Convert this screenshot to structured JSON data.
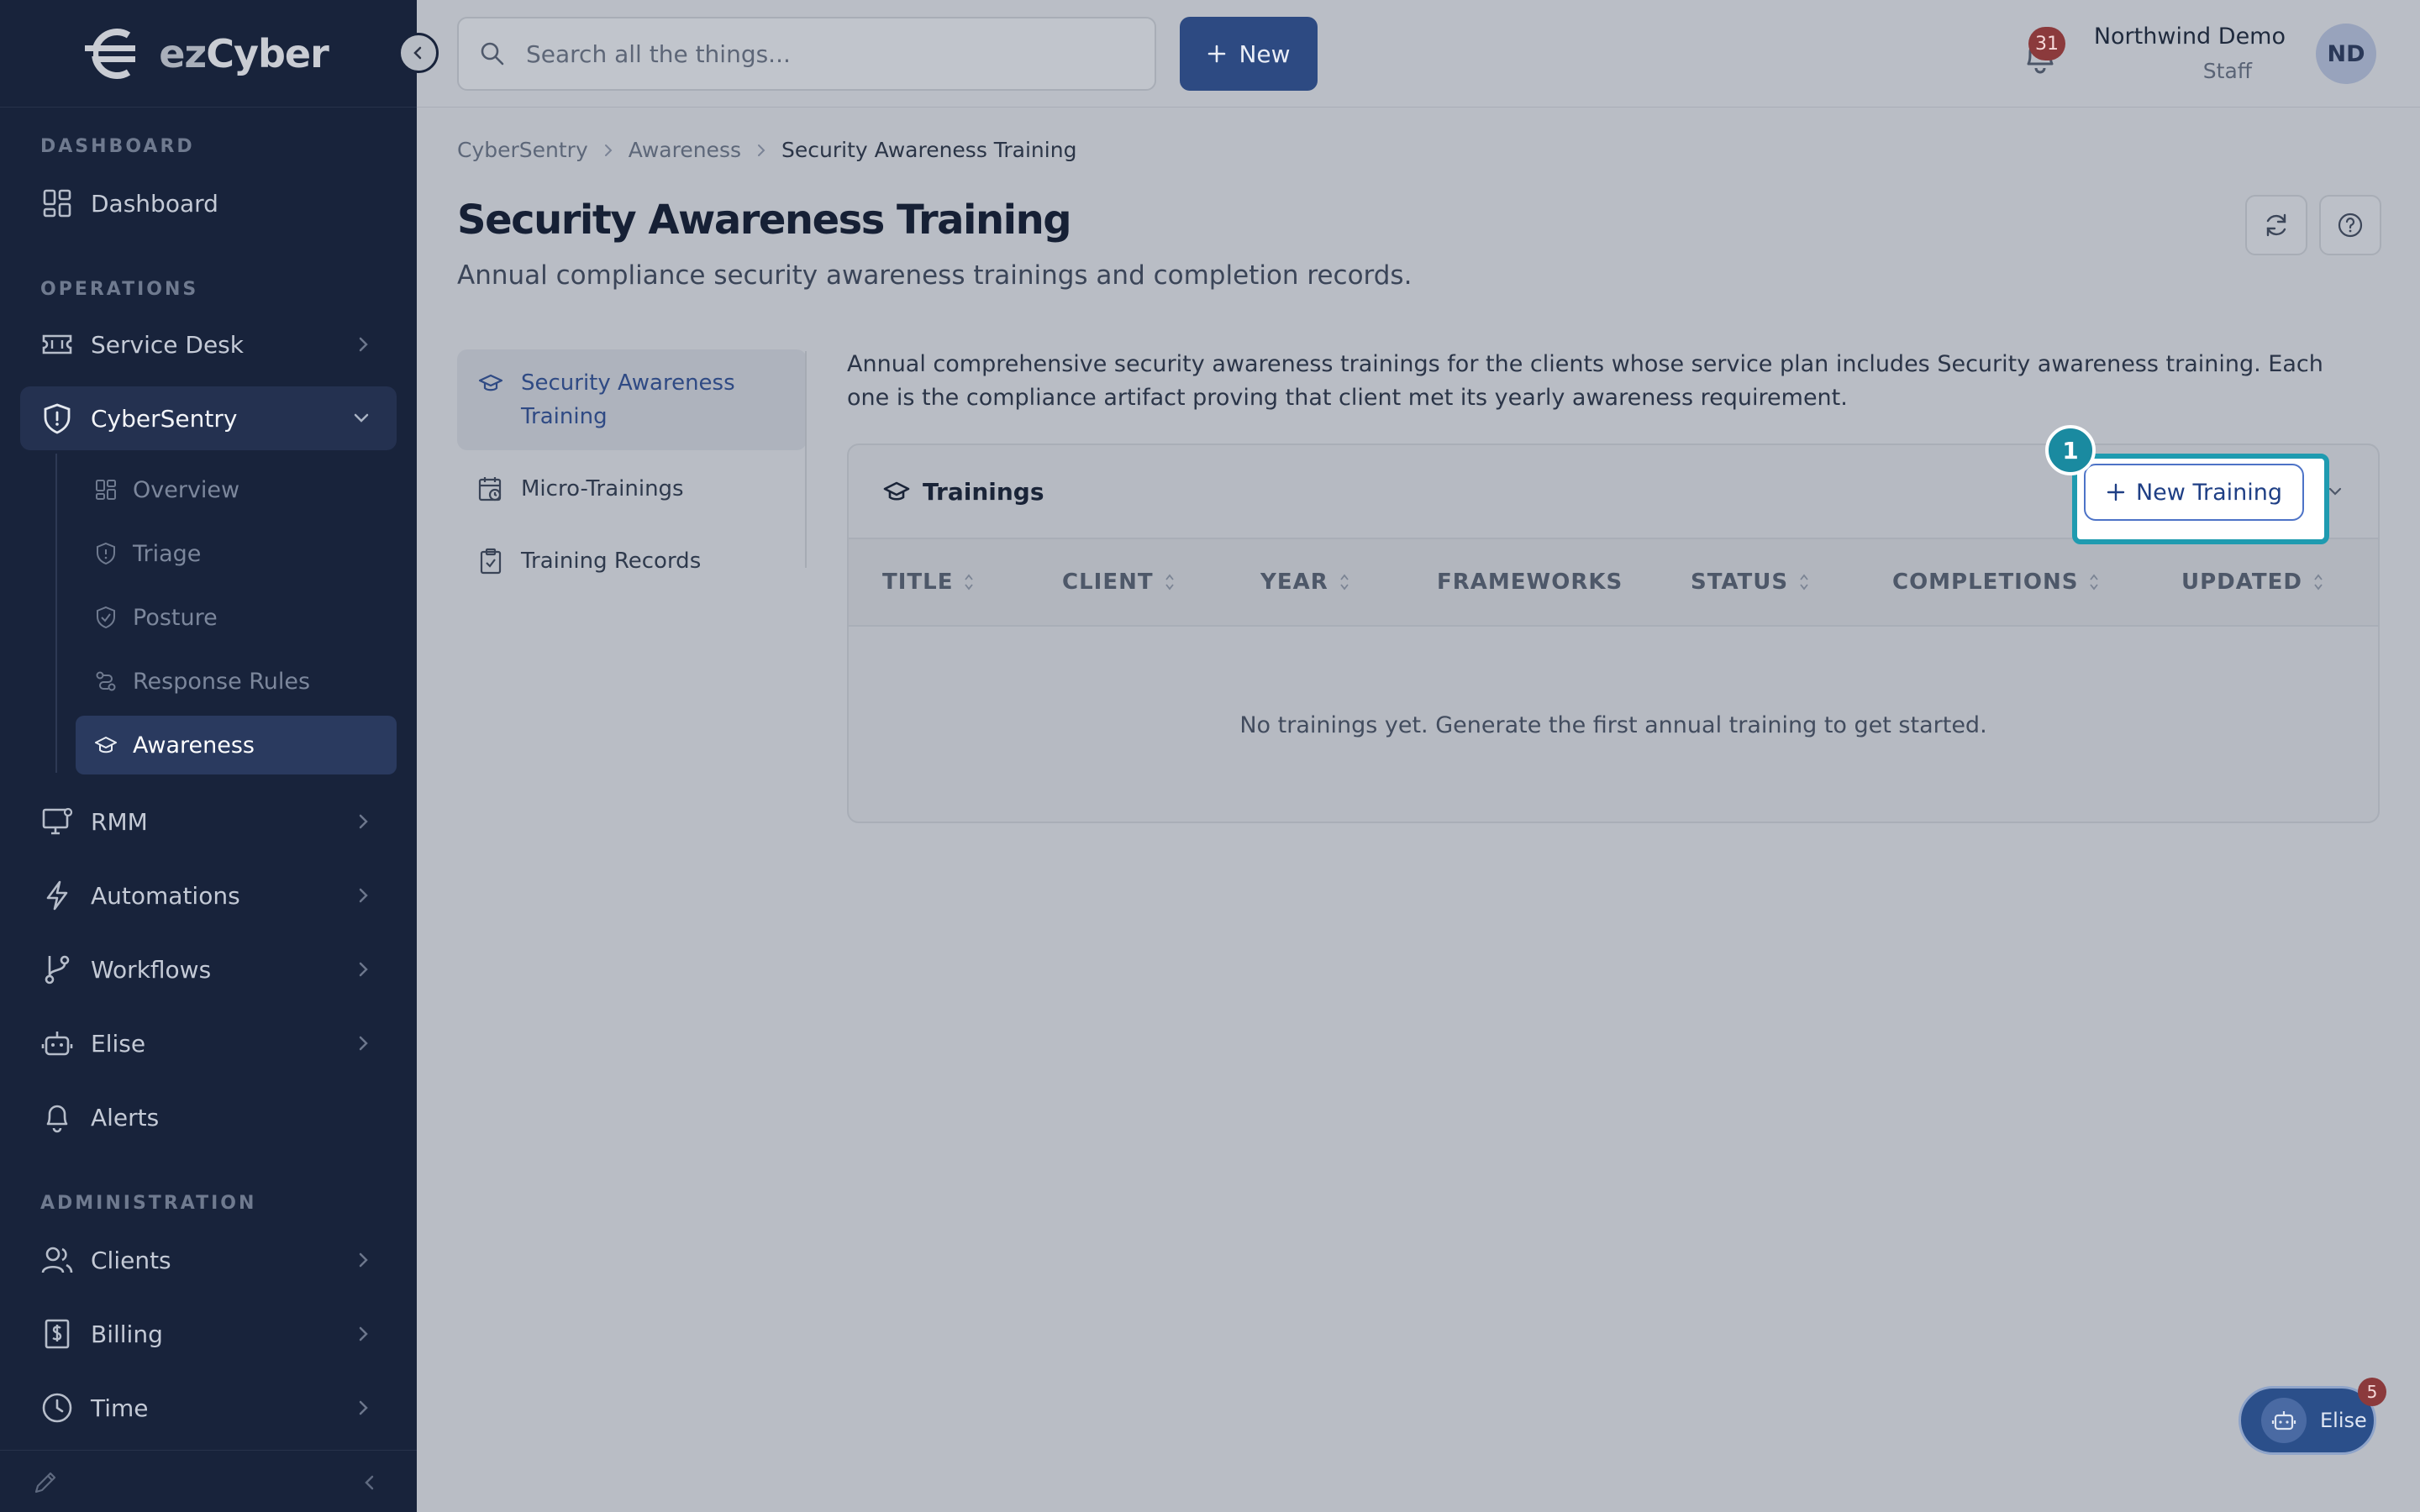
{
  "brand": {
    "name_prefix": "ez",
    "name_suffix": "Cyber"
  },
  "sidebar": {
    "sections": [
      "DASHBOARD",
      "OPERATIONS",
      "ADMINISTRATION"
    ],
    "items": [
      {
        "label": "Dashboard",
        "icon": "grid-icon"
      },
      {
        "label": "Service Desk",
        "icon": "ticket-icon"
      },
      {
        "label": "CyberSentry",
        "icon": "shield-icon",
        "expanded": true
      },
      {
        "label": "RMM",
        "icon": "monitor-icon"
      },
      {
        "label": "Automations",
        "icon": "bolt-icon"
      },
      {
        "label": "Workflows",
        "icon": "branch-icon"
      },
      {
        "label": "Elise",
        "icon": "robot-icon"
      },
      {
        "label": "Alerts",
        "icon": "bell-icon"
      },
      {
        "label": "Clients",
        "icon": "users-icon"
      },
      {
        "label": "Billing",
        "icon": "dollar-icon"
      },
      {
        "label": "Time",
        "icon": "clock-icon"
      }
    ],
    "subitems": [
      {
        "label": "Overview",
        "icon": "grid-icon"
      },
      {
        "label": "Triage",
        "icon": "shield-icon"
      },
      {
        "label": "Posture",
        "icon": "shield-check-icon"
      },
      {
        "label": "Response Rules",
        "icon": "route-icon"
      },
      {
        "label": "Awareness",
        "icon": "graduation-cap-icon",
        "active": true
      }
    ]
  },
  "topbar": {
    "search_placeholder": "Search all the things...",
    "new_label": "New",
    "notification_count": "31",
    "user_name": "Northwind Demo",
    "user_role": "Staff",
    "user_initials": "ND"
  },
  "breadcrumb": [
    "CyberSentry",
    "Awareness",
    "Security Awareness Training"
  ],
  "page": {
    "title": "Security Awareness Training",
    "subtitle": "Annual compliance security awareness trainings and completion records."
  },
  "subnav": [
    {
      "label": "Security Awareness Training",
      "icon": "graduation-cap-icon",
      "active": true
    },
    {
      "label": "Micro-Trainings",
      "icon": "calendar-clock-icon"
    },
    {
      "label": "Training Records",
      "icon": "clipboard-check-icon"
    }
  ],
  "description": "Annual comprehensive security awareness trainings for the clients whose service plan includes Security awareness training. Each one is the compliance artifact proving that client met its yearly awareness requirement.",
  "trainings": {
    "title": "Trainings",
    "new_button": "New Training",
    "columns": [
      "TITLE",
      "CLIENT",
      "YEAR",
      "FRAMEWORKS",
      "STATUS",
      "COMPLETIONS",
      "UPDATED"
    ],
    "empty_message": "No trainings yet. Generate the first annual training to get started."
  },
  "tutorial": {
    "step": "1"
  },
  "assistant": {
    "label": "Elise",
    "badge": "5"
  },
  "colors": {
    "sidebar_bg": "#18233b",
    "accent": "#2d4a82",
    "highlight": "#1f9bb0",
    "badge": "#8b3a3c"
  }
}
